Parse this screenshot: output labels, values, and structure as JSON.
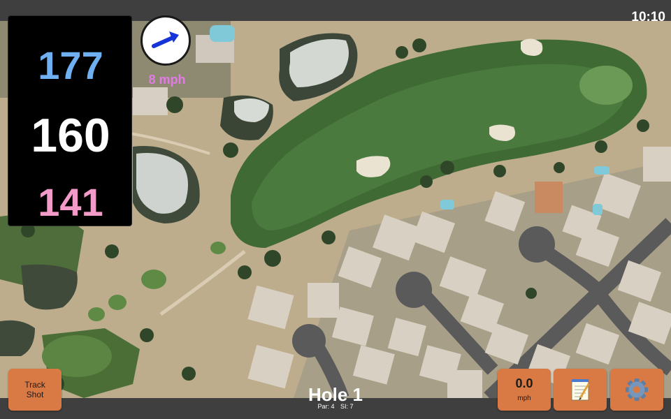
{
  "status": {
    "clock": "10:10"
  },
  "distances": {
    "back": "177",
    "middle": "160",
    "front": "141"
  },
  "wind": {
    "speed_label": "8 mph",
    "direction_icon": "wind-arrow-icon"
  },
  "hole": {
    "title": "Hole 1",
    "par": "Par: 4",
    "si": "SI: 7"
  },
  "buttons": {
    "track_shot_line1": "Track",
    "track_shot_line2": "Shot",
    "wind_value": "0.0",
    "wind_unit": "mph",
    "notes_icon": "notepad-icon",
    "settings_icon": "gear-icon"
  },
  "colors": {
    "back_distance": "#6fb0f2",
    "middle_distance": "#ffffff",
    "front_distance": "#f29ac8",
    "wind_label": "#e27ae7",
    "button": "#d97a45"
  }
}
